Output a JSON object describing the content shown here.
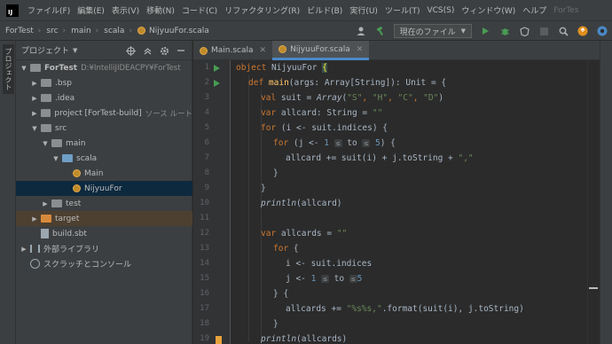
{
  "menubar": {
    "logo": "IJ",
    "items": [
      "ファイル(F)",
      "編集(E)",
      "表示(V)",
      "移動(N)",
      "コード(C)",
      "リファクタリング(R)",
      "ビルド(B)",
      "実行(U)",
      "ツール(T)",
      "VCS(S)",
      "ウィンドウ(W)",
      "ヘルプ"
    ],
    "title_fragment": "ForTes"
  },
  "breadcrumb": {
    "items": [
      "ForTest",
      "src",
      "main",
      "scala",
      "NijyuuFor.scala"
    ]
  },
  "toolbar": {
    "run_config_label": "現在のファイル"
  },
  "left_stripe": {
    "label": "プロジェクト"
  },
  "project_panel": {
    "title": "プロジェクト",
    "tree": [
      {
        "label": "ForTest",
        "extra": "D:¥IntelliJIDEACPY¥ForTest",
        "icon": "folder"
      },
      {
        "label": ".bsp",
        "icon": "folder"
      },
      {
        "label": ".idea",
        "icon": "folder"
      },
      {
        "label": "project [ForTest-build]",
        "extra": "ソース ルート",
        "icon": "folder"
      },
      {
        "label": "src",
        "icon": "folder"
      },
      {
        "label": "main",
        "icon": "folder"
      },
      {
        "label": "scala",
        "icon": "folder-blue"
      },
      {
        "label": "Main",
        "icon": "scala-object"
      },
      {
        "label": "NijyuuFor",
        "icon": "scala-object"
      },
      {
        "label": "test",
        "icon": "folder"
      },
      {
        "label": "target",
        "icon": "folder-orange"
      },
      {
        "label": "build.sbt",
        "icon": "file"
      },
      {
        "label": "外部ライブラリ",
        "icon": "library"
      },
      {
        "label": "スクラッチとコンソール",
        "icon": "scratch"
      }
    ]
  },
  "editor": {
    "tabs": [
      {
        "label": "Main.scala",
        "active": false
      },
      {
        "label": "NijyuuFor.scala",
        "active": true
      }
    ],
    "line_numbers": [
      "1",
      "2",
      "3",
      "4",
      "5",
      "6",
      "7",
      "8",
      "9",
      "10",
      "11",
      "12",
      "13",
      "14",
      "15",
      "16",
      "17",
      "18",
      "19"
    ],
    "code": {
      "l1_a": "object",
      "l1_b": " NijyuuFor ",
      "l1_c": "{",
      "l2_a": "def",
      "l2_b": "main",
      "l2_c": "(args: Array[String]): Unit = {",
      "l3_a": "val",
      "l3_b": " suit = ",
      "l3_c": "Array",
      "l3_d": "(",
      "l3_e": "\"S\"",
      "l3_f": ", ",
      "l3_g": "\"H\"",
      "l3_h": ", ",
      "l3_i": "\"C\"",
      "l3_j": ", ",
      "l3_k": "\"D\"",
      "l3_l": ")",
      "l4_a": "var",
      "l4_b": " allcard: String = ",
      "l4_c": "\"\"",
      "l5_a": "for",
      "l5_b": " (i <- suit.indices) {",
      "l6_a": "for",
      "l6_b": " (j <- ",
      "l6_c": "1",
      "l6_d": "≤",
      "l6_e": " to ",
      "l6_f": "≤",
      "l6_g": "5",
      "l6_h": ") {",
      "l7_a": "allcard += suit(i) + j.toString + ",
      "l7_b": "\",\"",
      "l8": "}",
      "l9": "}",
      "l10_a": "println",
      "l10_b": "(allcard)",
      "l12_a": "var",
      "l12_b": " allcards = ",
      "l12_c": "\"\"",
      "l13_a": "for",
      "l13_b": " {",
      "l14": "i <- suit.indices",
      "l15_a": "j <- ",
      "l15_b": "1",
      "l15_c": "≤",
      "l15_d": " to ",
      "l15_e": "≤",
      "l15_f": "5",
      "l16_a": "} ",
      "l16_b": "{",
      "l17_a": "allcards += ",
      "l17_b": "\"%s%s,\"",
      "l17_c": ".format(suit(i), j.toString)",
      "l18": "}",
      "l19_a": "println",
      "l19_b": "(allcards)"
    }
  },
  "colors": {
    "keyword": "#cc7832",
    "function": "#ffc66d",
    "string": "#6a8759",
    "number": "#6897bb",
    "selection": "#0d293e",
    "run_green": "#499c54"
  }
}
